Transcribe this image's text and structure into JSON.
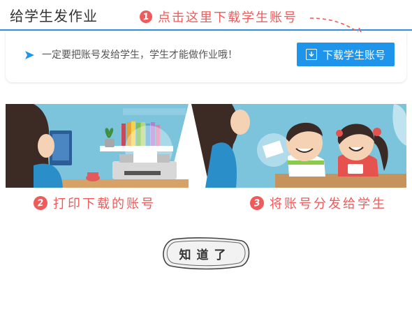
{
  "header": {
    "title": "给学生发作业"
  },
  "step1": {
    "number": "1",
    "text": "点击这里下载学生账号"
  },
  "notice": {
    "text": "一定要把账号发给学生，学生才能做作业哦！"
  },
  "download_button": {
    "label": "下载学生账号",
    "icon": "download-icon"
  },
  "steps": [
    {
      "number": "2",
      "text": "打印下载的账号"
    },
    {
      "number": "3",
      "text": "将账号分发给学生"
    }
  ],
  "ok_button": {
    "label": "知道了"
  },
  "colors": {
    "accent": "#2e8fe0",
    "button": "#1e95ea",
    "highlight": "#f05a5a",
    "scene_bg": "#7cc4dc"
  }
}
